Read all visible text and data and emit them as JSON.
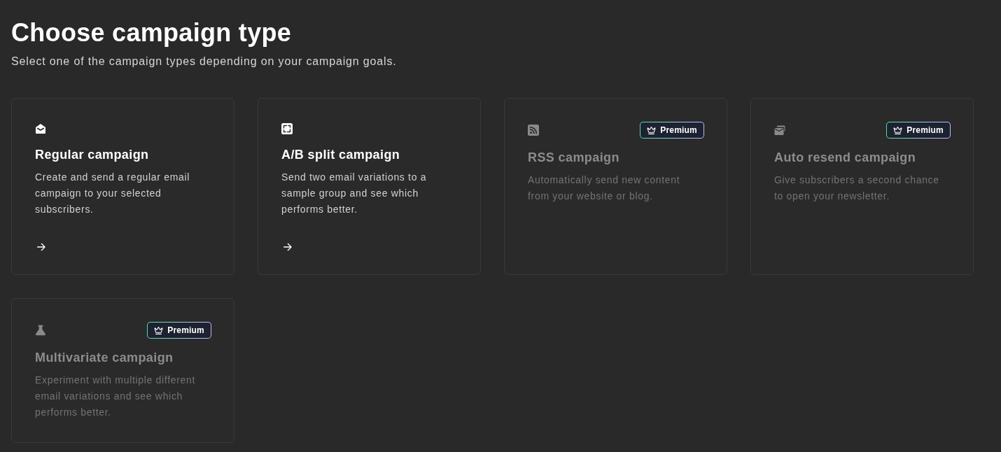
{
  "page": {
    "title": "Choose campaign type",
    "subtitle": "Select one of the campaign types depending on your campaign goals."
  },
  "cards": [
    {
      "title": "Regular campaign",
      "description": "Create and send a regular email campaign to your selected subscribers.",
      "disabled": false
    },
    {
      "title": "A/B split campaign",
      "description": "Send two email variations to a sample group and see which performs better.",
      "disabled": false
    },
    {
      "title": "RSS campaign",
      "description": "Automatically send new content from your website or blog.",
      "badge": "Premium",
      "disabled": true
    },
    {
      "title": "Auto resend campaign",
      "description": "Give subscribers a second chance to open your newsletter.",
      "badge": "Premium",
      "disabled": true
    },
    {
      "title": "Multivariate campaign",
      "description": "Experiment with multiple different email variations and see which performs better.",
      "badge": "Premium",
      "disabled": true
    }
  ]
}
